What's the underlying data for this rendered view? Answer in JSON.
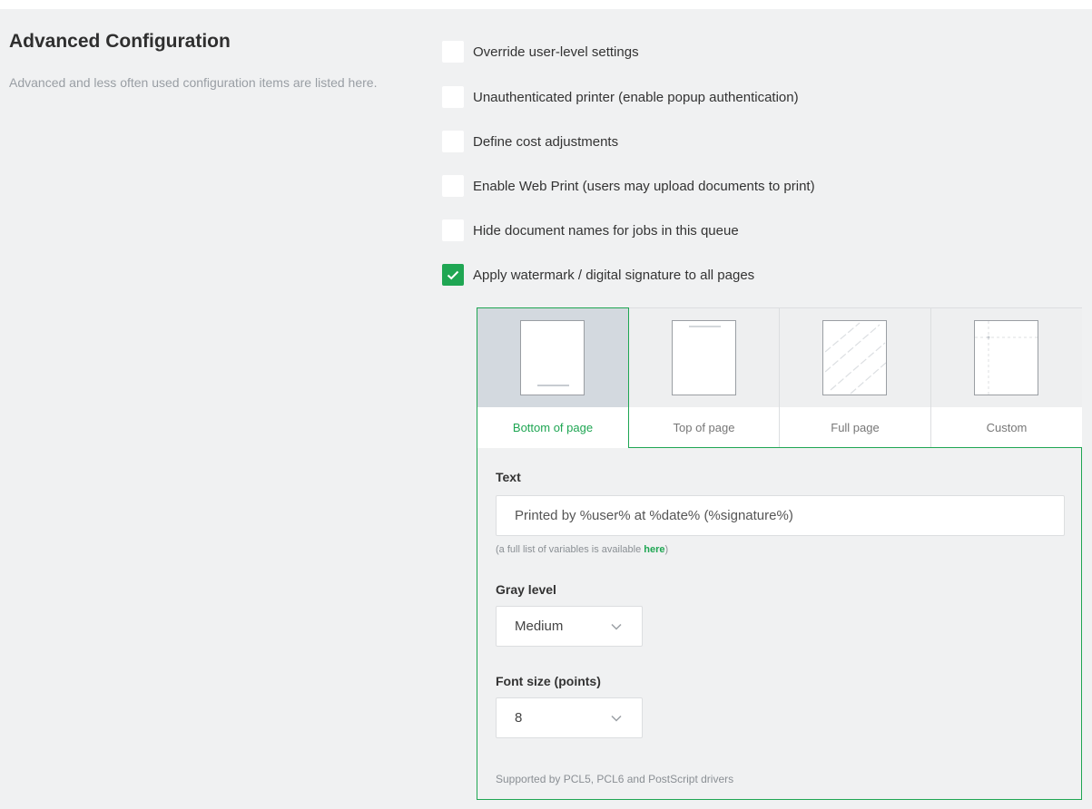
{
  "section": {
    "title": "Advanced Configuration",
    "description": "Advanced and less often used configuration items are listed here."
  },
  "options": [
    {
      "label": "Override user-level settings",
      "checked": false
    },
    {
      "label": "Unauthenticated printer (enable popup authentication)",
      "checked": false
    },
    {
      "label": "Define cost adjustments",
      "checked": false
    },
    {
      "label": "Enable Web Print (users may upload documents to print)",
      "checked": false
    },
    {
      "label": "Hide document names for jobs in this queue",
      "checked": false
    },
    {
      "label": "Apply watermark / digital signature to all pages",
      "checked": true
    }
  ],
  "watermark": {
    "tabs": [
      {
        "label": "Bottom of page",
        "active": true
      },
      {
        "label": "Top of page",
        "active": false
      },
      {
        "label": "Full page",
        "active": false
      },
      {
        "label": "Custom",
        "active": false
      }
    ],
    "text_label": "Text",
    "text_value": "Printed by %user% at %date% (%signature%)",
    "hint_prefix": "(a full list of variables is available ",
    "hint_link": "here",
    "hint_suffix": ")",
    "gray_label": "Gray level",
    "gray_value": "Medium",
    "font_label": "Font size (points)",
    "font_value": "8",
    "footer": "Supported by PCL5, PCL6 and PostScript drivers"
  },
  "colors": {
    "accent": "#1fa653",
    "panel_bg": "#f0f1f2",
    "muted_text": "#999ea4"
  }
}
